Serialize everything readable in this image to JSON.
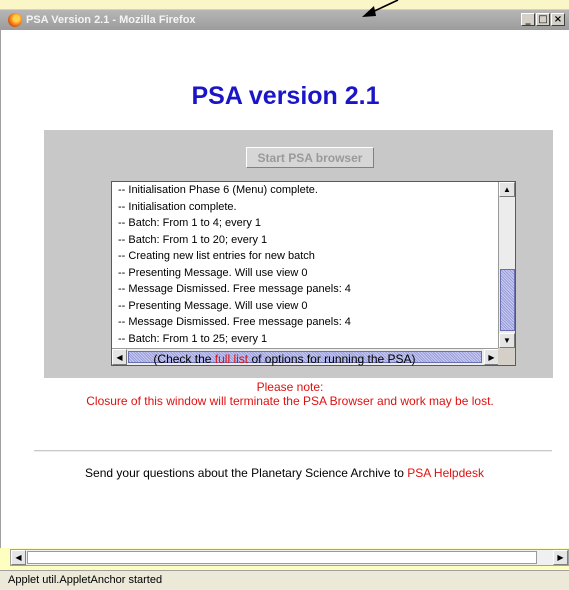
{
  "window": {
    "title": "PSA Version 2.1 - Mozilla Firefox"
  },
  "window_buttons": [
    "_",
    "□",
    "×"
  ],
  "page": {
    "title": "PSA version 2.1",
    "start_button_label": "Start PSA browser"
  },
  "log": {
    "lines": [
      "-- Initialisation Phase 6 (Menu) complete.",
      "-- Initialisation complete.",
      "-- Batch: From 1 to 4; every 1",
      "-- Batch: From 1 to 20; every 1",
      "-- Creating new list entries for new batch",
      "-- Presenting Message. Will use view 0",
      "-- Message Dismissed. Free message panels: 4",
      "-- Presenting Message. Will use view 0",
      "-- Message Dismissed. Free message panels: 4",
      "-- Batch: From 1 to 25; every 1"
    ]
  },
  "check": {
    "prefix": "(Check the ",
    "link": "full list",
    "suffix": " of options for running the PSA)"
  },
  "note": {
    "heading": "Please note:",
    "body": "Closure of this window will terminate the PSA Browser and work may be lost."
  },
  "questions": {
    "text": "Send your questions about the Planetary Science Archive to ",
    "link": "PSA Helpdesk"
  },
  "status": {
    "text": "Applet util.AppletAnchor started"
  },
  "colors": {
    "title_blue": "#1a16c8",
    "link_red": "#e01010",
    "panel_gray": "#c8c8c8"
  }
}
